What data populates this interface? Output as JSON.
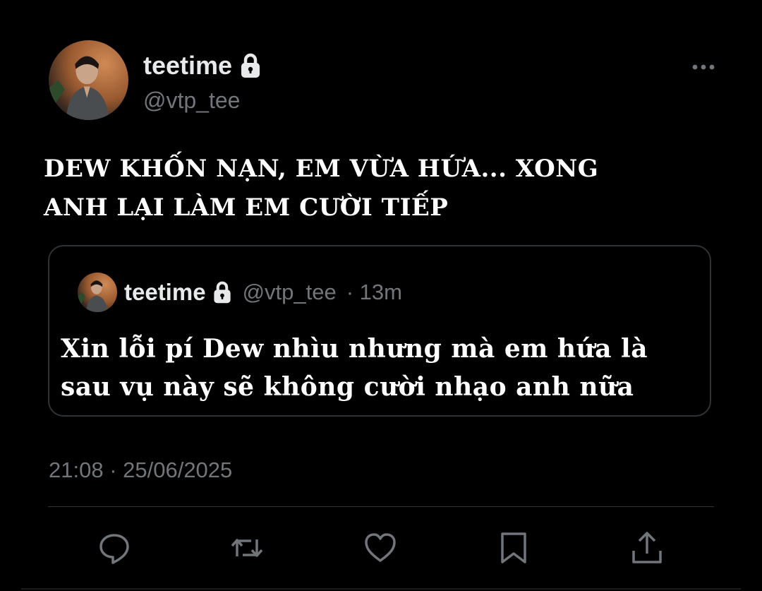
{
  "author": {
    "display_name": "teetime",
    "handle": "@vtp_tee",
    "protected": true
  },
  "tweet": {
    "text_line1": "DEW KHỐN NẠN, EM VỪA HỨA... XONG",
    "text_line2": "ANH LẠI LÀM EM CƯỜI TIẾP",
    "timestamp": "21:08 · 25/06/2025"
  },
  "quoted": {
    "display_name": "teetime",
    "handle": "@vtp_tee",
    "meta": "· 13m",
    "text_line1": "Xin lỗi pí Dew nhìu nhưng mà em hứa là",
    "text_line2": "sau vụ này sẽ không cười nhạo anh nữa"
  },
  "actions": [
    {
      "icon": "reply-icon"
    },
    {
      "icon": "retweet-icon"
    },
    {
      "icon": "like-icon"
    },
    {
      "icon": "bookmark-icon"
    },
    {
      "icon": "share-icon"
    }
  ],
  "colors": {
    "background": "#000000",
    "text_primary": "#e7e9ea",
    "text_secondary": "#71767b",
    "border": "#2f3336"
  }
}
